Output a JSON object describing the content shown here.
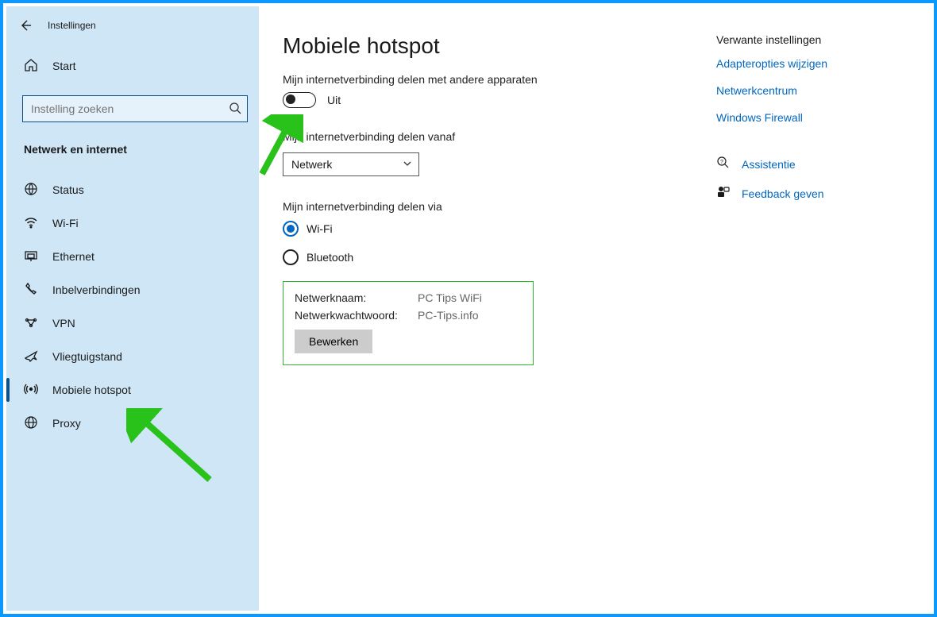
{
  "app_title": "Instellingen",
  "search": {
    "placeholder": "Instelling zoeken"
  },
  "section_label": "Netwerk en internet",
  "sidebar": {
    "start": {
      "label": "Start"
    },
    "items": [
      {
        "key": "status",
        "label": "Status"
      },
      {
        "key": "wifi",
        "label": "Wi-Fi"
      },
      {
        "key": "ethernet",
        "label": "Ethernet"
      },
      {
        "key": "dialup",
        "label": "Inbelverbindingen"
      },
      {
        "key": "vpn",
        "label": "VPN"
      },
      {
        "key": "airplane",
        "label": "Vliegtuigstand"
      },
      {
        "key": "hotspot",
        "label": "Mobiele hotspot"
      },
      {
        "key": "proxy",
        "label": "Proxy"
      }
    ]
  },
  "page": {
    "title": "Mobiele hotspot",
    "share_heading": "Mijn internetverbinding delen met andere apparaten",
    "toggle_state": "Uit",
    "share_from_heading": "Mijn internetverbinding delen vanaf",
    "share_from_value": "Netwerk",
    "share_via_heading": "Mijn internetverbinding delen via",
    "radio_wifi": "Wi-Fi",
    "radio_bluetooth": "Bluetooth",
    "network_name_label": "Netwerknaam:",
    "network_name_value": "PC Tips WiFi",
    "network_password_label": "Netwerkwachtwoord:",
    "network_password_value": "PC-Tips.info",
    "edit_button": "Bewerken"
  },
  "related": {
    "heading": "Verwante instellingen",
    "links": [
      "Adapteropties wijzigen",
      "Netwerkcentrum",
      "Windows Firewall"
    ],
    "assist": "Assistentie",
    "feedback": "Feedback geven"
  }
}
